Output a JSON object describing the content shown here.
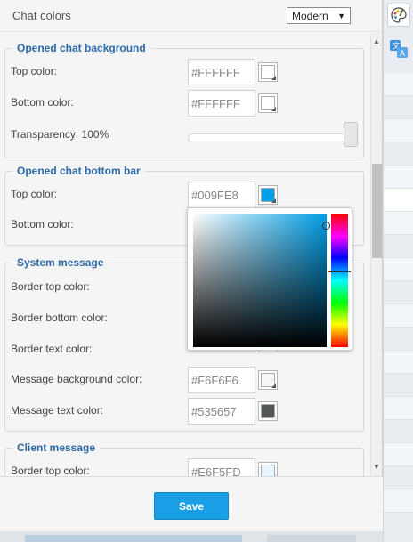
{
  "panel": {
    "title": "Chat colors",
    "theme_select": "Modern",
    "save_label": "Save"
  },
  "sections": {
    "opened_bg": {
      "legend": "Opened chat background",
      "top_label": "Top color:",
      "top_value": "#FFFFFF",
      "bottom_label": "Bottom color:",
      "bottom_value": "#FFFFFF",
      "transparency_label": "Transparency: 100%",
      "transparency_level": 100
    },
    "bottom_bar": {
      "legend": "Opened chat bottom bar",
      "top_label": "Top color:",
      "top_value": "#009FE8",
      "bottom_label": "Bottom color:"
    },
    "system_message": {
      "legend": "System message",
      "border_top_label": "Border top color:",
      "border_bottom_label": "Border bottom color:",
      "border_text_label": "Border text color:",
      "msg_bg_label": "Message background color:",
      "msg_bg_value": "#F6F6F6",
      "msg_text_label": "Message text color:",
      "msg_text_value": "#535657"
    },
    "client_message": {
      "legend": "Client message",
      "border_top_label": "Border top color:",
      "border_top_value": "#E6F5FD"
    }
  },
  "colors": {
    "accent": "#1a9fe6",
    "legend_blue": "#2d6aa8",
    "bottom_bar_top": "#009FE8",
    "message_text": "#535657",
    "message_bg": "#F6F6F6",
    "client_border_top": "#E6F5FD"
  },
  "icons": {
    "strip_top": "palette-icon",
    "strip_second": "translate-icon"
  }
}
